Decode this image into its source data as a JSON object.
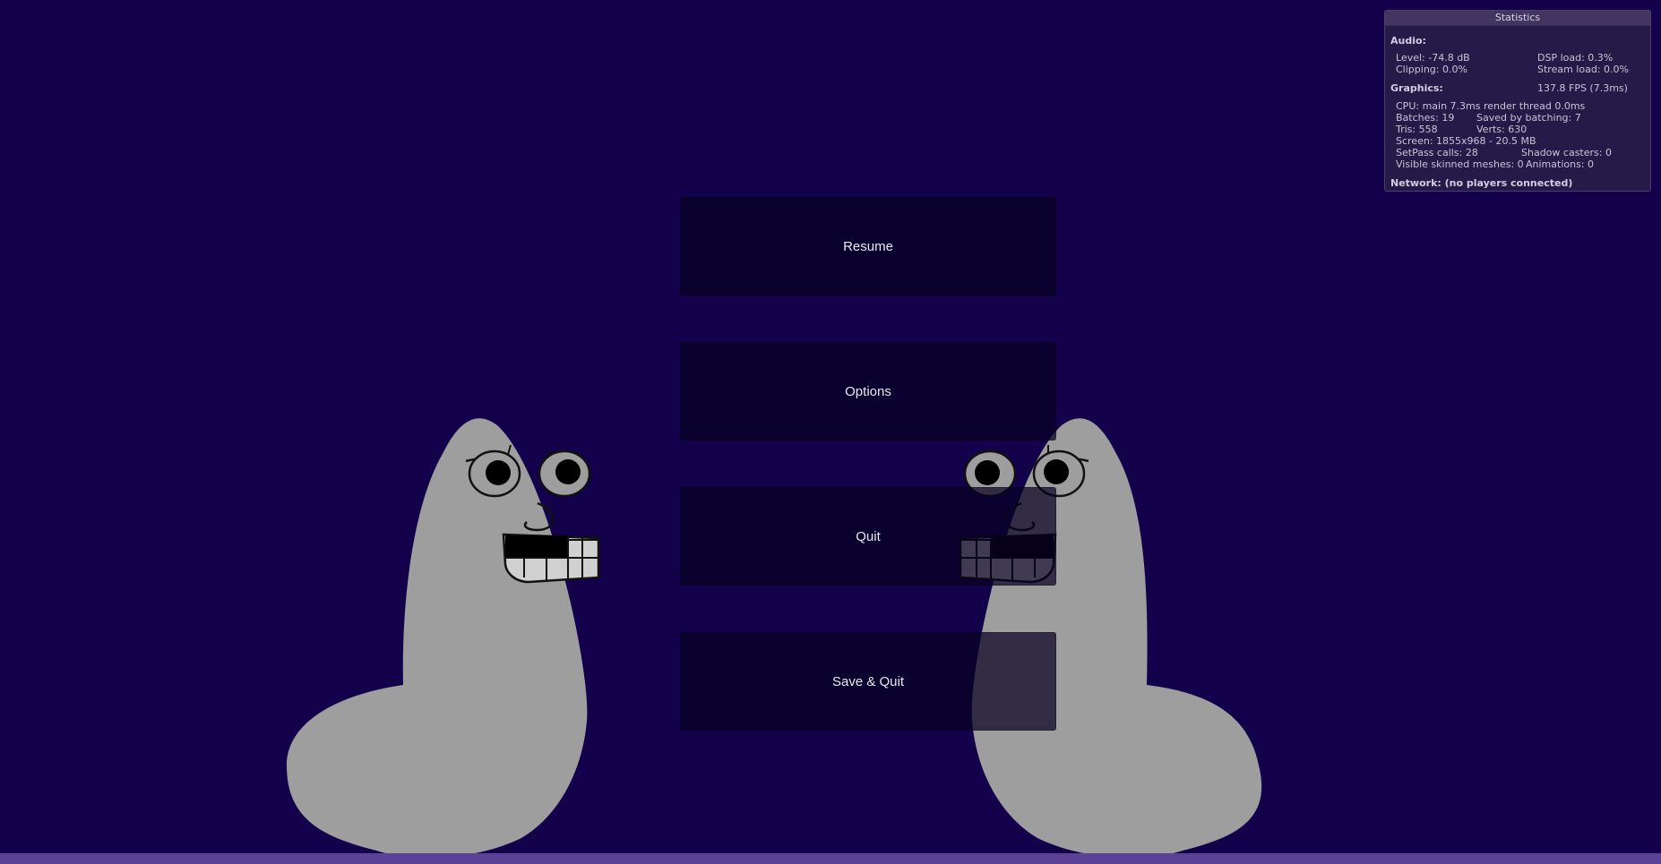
{
  "menu": {
    "resume_label": "Resume",
    "options_label": "Options",
    "quit_label": "Quit",
    "save_quit_label": "Save & Quit"
  },
  "stats": {
    "title": "Statistics",
    "audio_heading": "Audio:",
    "level": "Level: -74.8 dB",
    "dsp_load": "DSP load: 0.3%",
    "clipping": "Clipping: 0.0%",
    "stream_load": "Stream load: 0.0%",
    "graphics_heading": "Graphics:",
    "fps": "137.8 FPS (7.3ms)",
    "cpu": "CPU: main 7.3ms  render thread 0.0ms",
    "batches": "Batches: 19",
    "saved_by_batching": "Saved by batching: 7",
    "tris": "Tris: 558",
    "verts": "Verts: 630",
    "screen": "Screen: 1855x968 - 20.5 MB",
    "setpass": "SetPass calls: 28",
    "shadow_casters": "Shadow casters: 0",
    "skinned_meshes": "Visible skinned meshes: 0",
    "animations": "Animations: 0",
    "network": "Network: (no players connected)"
  },
  "colors": {
    "background": "#13024b",
    "creature": "#9e9e9e",
    "bottom_bar": "#5b4296"
  },
  "characters": [
    "creature-left",
    "creature-right"
  ]
}
